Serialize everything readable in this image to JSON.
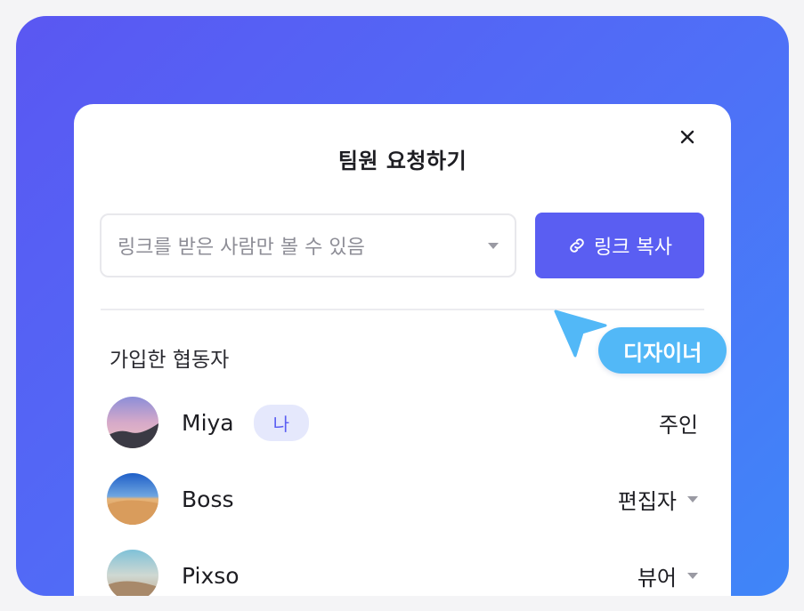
{
  "dialog": {
    "title": "팀원 요청하기",
    "close_icon": "close-icon"
  },
  "share": {
    "access_option": "링크를 받은 사람만 볼 수 있음",
    "copy_label": "링크 복사",
    "copy_icon": "link-icon"
  },
  "collaborators": {
    "heading": "가입한 협동자",
    "items": [
      {
        "name": "Miya",
        "badge": "나",
        "role": "주인",
        "has_dropdown": false
      },
      {
        "name": "Boss",
        "role": "편집자",
        "has_dropdown": true
      },
      {
        "name": "Pixso",
        "role": "뷰어",
        "has_dropdown": true
      }
    ]
  },
  "cursor": {
    "label": "디자이너",
    "color": "#52b8f7"
  },
  "colors": {
    "accent": "#5a5ef2",
    "background_gradient_start": "#5a57f2",
    "background_gradient_end": "#3f86f8"
  }
}
